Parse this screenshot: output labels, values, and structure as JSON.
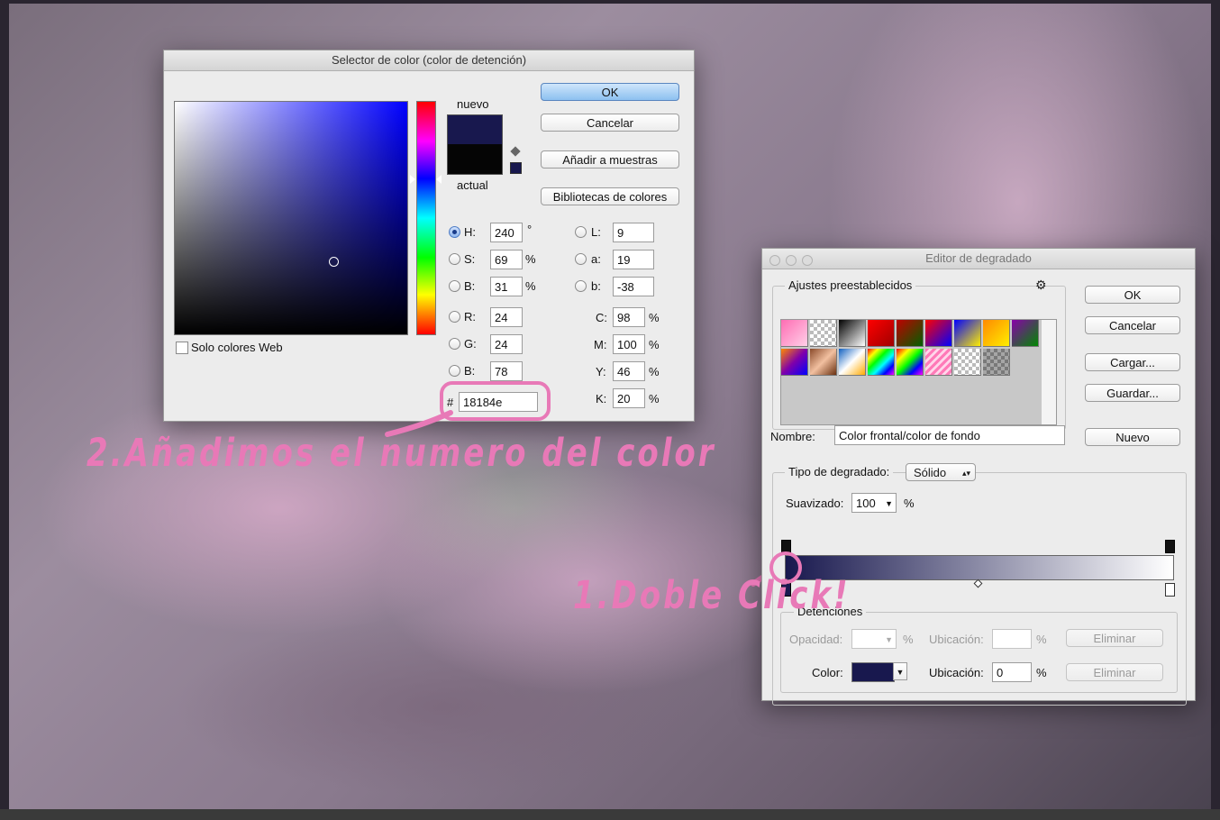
{
  "color_picker": {
    "title": "Selector de color (color de detención)",
    "ok_label": "OK",
    "cancel_label": "Cancelar",
    "add_swatch_label": "Añadir a muestras",
    "libraries_label": "Bibliotecas de colores",
    "new_label": "nuevo",
    "current_label": "actual",
    "web_only_label": "Solo colores Web",
    "new_color": "#18184e",
    "current_color": "#050505",
    "fields": {
      "H": {
        "label": "H:",
        "value": "240",
        "unit": "°"
      },
      "S": {
        "label": "S:",
        "value": "69",
        "unit": "%"
      },
      "Bv": {
        "label": "B:",
        "value": "31",
        "unit": "%"
      },
      "R": {
        "label": "R:",
        "value": "24"
      },
      "G": {
        "label": "G:",
        "value": "24"
      },
      "B": {
        "label": "B:",
        "value": "78"
      },
      "L": {
        "label": "L:",
        "value": "9"
      },
      "a": {
        "label": "a:",
        "value": "19"
      },
      "b": {
        "label": "b:",
        "value": "-38"
      },
      "C": {
        "label": "C:",
        "value": "98",
        "unit": "%"
      },
      "M": {
        "label": "M:",
        "value": "100",
        "unit": "%"
      },
      "Y": {
        "label": "Y:",
        "value": "46",
        "unit": "%"
      },
      "K": {
        "label": "K:",
        "value": "20",
        "unit": "%"
      }
    },
    "hex_prefix": "#",
    "hex_value": "18184e"
  },
  "gradient_editor": {
    "title": "Editor de degradado",
    "presets_label": "Ajustes preestablecidos",
    "ok_label": "OK",
    "cancel_label": "Cancelar",
    "load_label": "Cargar...",
    "save_label": "Guardar...",
    "name_label": "Nombre:",
    "name_value": "Color frontal/color de fondo",
    "new_label": "Nuevo",
    "type_label": "Tipo de degradado:",
    "type_value": "Sólido",
    "smoothness_label": "Suavizado:",
    "smoothness_value": "100",
    "smoothness_unit": "%",
    "stops_title": "Detenciones",
    "opacity_label": "Opacidad:",
    "opacity_unit": "%",
    "location_label": "Ubicación:",
    "location_unit": "%",
    "delete_label": "Eliminar",
    "color_label": "Color:",
    "color_location_value": "0",
    "stop_color": "#18184e"
  },
  "annotations": {
    "step2": "2.Añadimos el numero del color",
    "step1": "1.Doble Click!",
    "color": "#e879b7"
  }
}
